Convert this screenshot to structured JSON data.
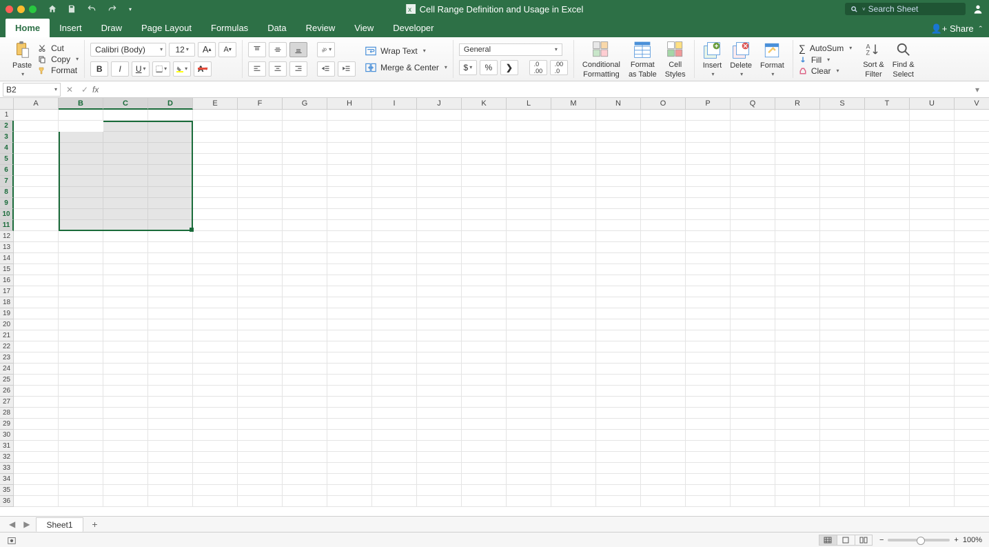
{
  "title": "Cell Range Definition and Usage in Excel",
  "search_placeholder": "Search Sheet",
  "share_label": "Share",
  "tabs": [
    "Home",
    "Insert",
    "Draw",
    "Page Layout",
    "Formulas",
    "Data",
    "Review",
    "View",
    "Developer"
  ],
  "active_tab": "Home",
  "clipboard": {
    "paste": "Paste",
    "cut": "Cut",
    "copy": "Copy",
    "format": "Format"
  },
  "font": {
    "name": "Calibri (Body)",
    "size": "12"
  },
  "alignment": {
    "wrap": "Wrap Text",
    "merge": "Merge & Center"
  },
  "number": {
    "format": "General"
  },
  "styles": {
    "cond": "Conditional",
    "cond2": "Formatting",
    "table": "Format",
    "table2": "as Table",
    "cell": "Cell",
    "cell2": "Styles"
  },
  "cells": {
    "insert": "Insert",
    "delete": "Delete",
    "format": "Format"
  },
  "editing": {
    "autosum": "AutoSum",
    "fill": "Fill",
    "clear": "Clear",
    "sort": "Sort &",
    "sort2": "Filter",
    "find": "Find &",
    "find2": "Select"
  },
  "namebox": "B2",
  "formula": "",
  "columns": [
    "A",
    "B",
    "C",
    "D",
    "E",
    "F",
    "G",
    "H",
    "I",
    "J",
    "K",
    "L",
    "M",
    "N",
    "O",
    "P",
    "Q",
    "R",
    "S",
    "T",
    "U",
    "V"
  ],
  "selected_cols": [
    "B",
    "C",
    "D"
  ],
  "rows": 36,
  "selected_rows": [
    2,
    3,
    4,
    5,
    6,
    7,
    8,
    9,
    10,
    11
  ],
  "sheet": "Sheet1",
  "zoom": "100%"
}
